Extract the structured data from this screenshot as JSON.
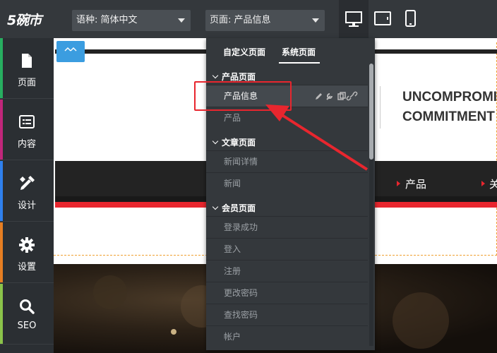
{
  "topbar": {
    "logo": "5碗市",
    "language_select": {
      "label": "语种:",
      "value": "简体中文"
    },
    "page_select": {
      "label": "页面:",
      "value": "产品信息"
    },
    "devices": [
      "desktop-icon",
      "tablet-icon",
      "phone-icon"
    ]
  },
  "sidebar": {
    "items": [
      {
        "label": "页面",
        "icon": "page-icon",
        "color": "#27ae60"
      },
      {
        "label": "内容",
        "icon": "list-icon",
        "color": "#c0267a"
      },
      {
        "label": "设计",
        "icon": "design-icon",
        "color": "#2f80ed"
      },
      {
        "label": "设置",
        "icon": "gear-icon",
        "color": "#e67e22"
      },
      {
        "label": "SEO",
        "icon": "search-icon",
        "color": "#8bc34a"
      }
    ]
  },
  "dropdown": {
    "tabs": [
      "自定义页面",
      "系统页面"
    ],
    "active_tab": "系统页面",
    "groups": [
      {
        "title": "产品页面",
        "items": [
          "产品信息",
          "产品"
        ]
      },
      {
        "title": "文章页面",
        "items": [
          "新闻详情",
          "新闻"
        ]
      },
      {
        "title": "会员页面",
        "items": [
          "登录成功",
          "登入",
          "注册",
          "更改密码",
          "查找密码",
          "帐户"
        ]
      }
    ],
    "active_item": "产品信息",
    "item_tools": [
      "edit-icon",
      "wrench-icon",
      "copy-icon",
      "link-icon"
    ]
  },
  "canvas": {
    "hero_line1": "UNCOMPROMISI",
    "hero_line2": "COMMITMENT TO",
    "nav_items": [
      "产品",
      "关"
    ]
  },
  "colors": {
    "accent_red": "#e8262e",
    "tag_blue": "#3b9de0",
    "panel_bg": "#34383c"
  }
}
